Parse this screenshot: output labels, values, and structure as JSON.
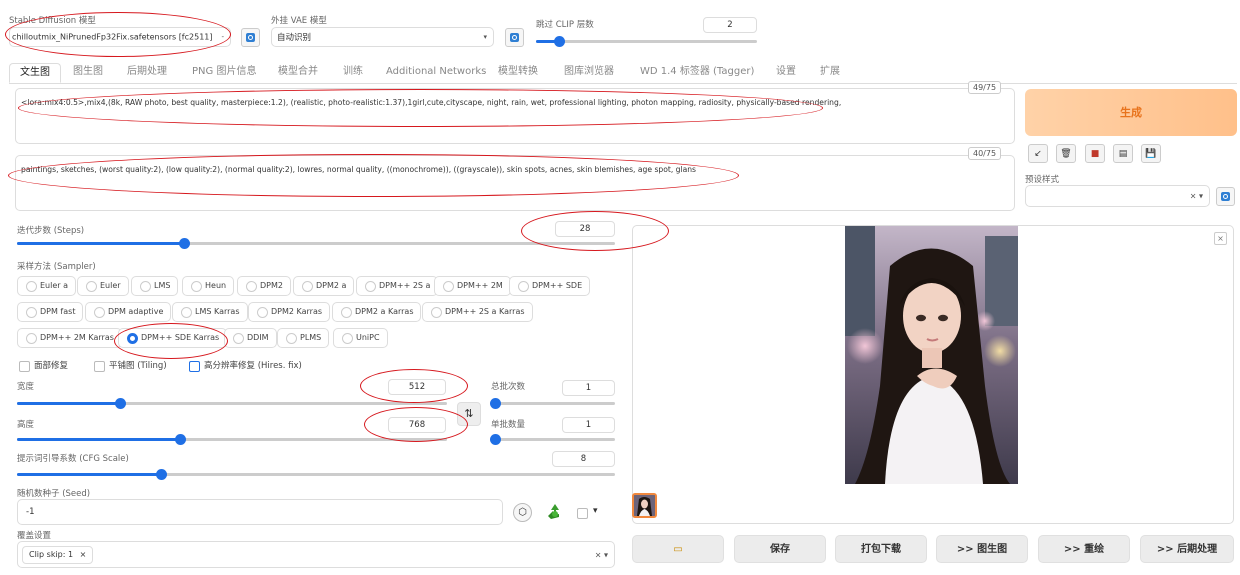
{
  "top": {
    "sd_model_label": "Stable Diffusion 模型",
    "sd_model_value": "chilloutmix_NiPrunedFp32Fix.safetensors [fc2511]",
    "vae_label": "外挂 VAE 模型",
    "vae_value": "自动识别",
    "clip_label": "跳过 CLIP 层数",
    "clip_value": "2"
  },
  "tabs": [
    "文生图",
    "图生图",
    "后期处理",
    "PNG 图片信息",
    "模型合并",
    "训练",
    "Additional Networks",
    "模型转换",
    "图库浏览器",
    "WD 1.4 标签器 (Tagger)",
    "设置",
    "扩展"
  ],
  "prompt": {
    "positive_text": "<lora:mix4:0.5>,mix4,(8k, RAW photo, best quality, masterpiece:1.2), (realistic, photo-realistic:1.37),1girl,cute,cityscape, night, rain, wet, professional lighting, photon mapping, radiosity, physically-based rendering,",
    "positive_count": "49/75",
    "negative_text": "paintings, sketches, (worst quality:2), (low quality:2), (normal quality:2), lowres, normal quality, ((monochrome)), ((grayscale)), skin spots, acnes, skin blemishes, age spot, glans",
    "negative_count": "40/75"
  },
  "actions": {
    "generate_label": "生成",
    "tools": [
      "↙",
      "🗑",
      "■",
      "▤",
      "💾"
    ],
    "style_label": "预设样式",
    "style_clear": "× ▾"
  },
  "params": {
    "steps_label": "迭代步数 (Steps)",
    "steps_value": "28",
    "steps_fraction": 0.28,
    "sampler_label": "采样方法 (Sampler)",
    "samplers": [
      "Euler a",
      "Euler",
      "LMS",
      "Heun",
      "DPM2",
      "DPM2 a",
      "DPM++ 2S a",
      "DPM++ 2M",
      "DPM++ SDE",
      "DPM fast",
      "DPM adaptive",
      "LMS Karras",
      "DPM2 Karras",
      "DPM2 a Karras",
      "DPM++ 2S a Karras",
      "DPM++ 2M Karras",
      "DPM++ SDE Karras",
      "DDIM",
      "PLMS",
      "UniPC"
    ],
    "sampler_selected": "DPM++ SDE Karras",
    "restore_faces": "面部修复",
    "tiling": "平铺图 (Tiling)",
    "hires_fix": "高分辨率修复 (Hires. fix)",
    "width_label": "宽度",
    "width_value": "512",
    "width_fraction": 0.24,
    "height_label": "高度",
    "height_value": "768",
    "height_fraction": 0.38,
    "swap_label": "⇅",
    "batch_count_label": "总批次数",
    "batch_count_value": "1",
    "batch_size_label": "单批数量",
    "batch_size_value": "1",
    "cfg_label": "提示词引导系数 (CFG Scale)",
    "cfg_value": "8",
    "cfg_fraction": 0.24,
    "seed_label": "随机数种子 (Seed)",
    "seed_value": "-1",
    "seed_extra": "▾",
    "override_label": "覆盖设置",
    "override_tag": "Clip skip: 1",
    "override_tag_x": "×",
    "override_clear": "× ▾"
  },
  "output": {
    "close": "×",
    "buttons": [
      "▭",
      "保存",
      "打包下载",
      ">> 图生图",
      ">> 重绘",
      ">> 后期处理"
    ]
  },
  "colors": {
    "accent": "#1f6fe5",
    "generate_text": "#e8731c",
    "annotation": "#d6181e"
  }
}
